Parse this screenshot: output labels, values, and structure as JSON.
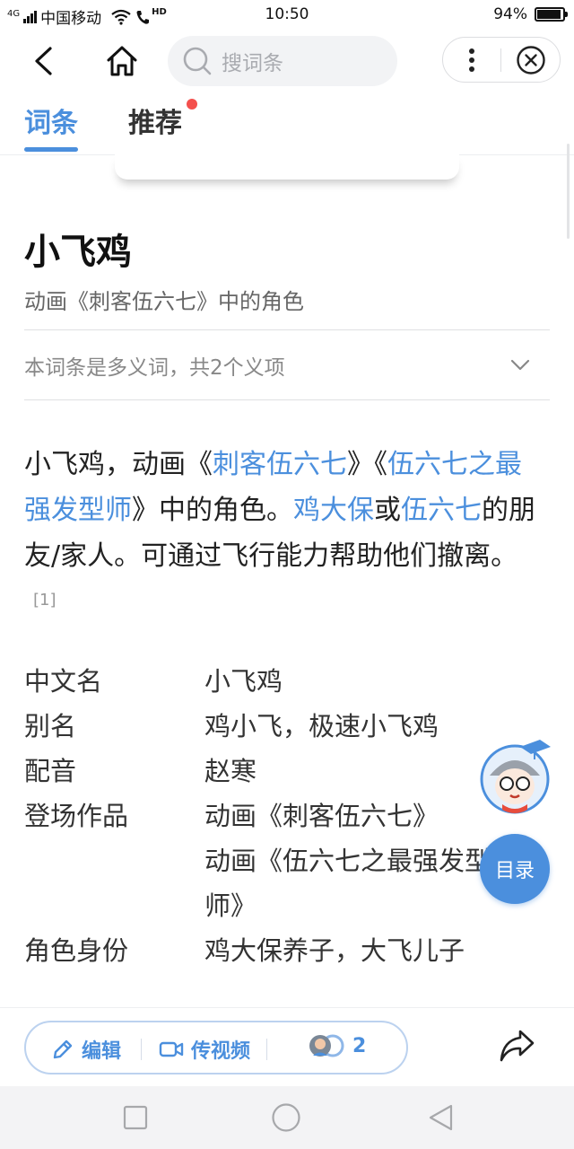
{
  "status_bar": {
    "network": "4G",
    "carrier": "中国移动",
    "hd": "HD",
    "time": "10:50",
    "battery": "94%",
    "battery_level": 0.94
  },
  "nav": {
    "search_placeholder": "搜词条"
  },
  "tabs": [
    {
      "label": "词条",
      "active": true
    },
    {
      "label": "推荐",
      "active": false,
      "has_badge": true
    }
  ],
  "entry": {
    "title": "小飞鸡",
    "subtitle": "动画《刺客伍六七》中的角色",
    "polysemy_note": "本词条是多义词，共2个义项",
    "summary": {
      "p1": "小飞鸡，动画《",
      "l1": "刺客伍六七",
      "p2": "》《",
      "l2": "伍六七之最强发型师",
      "p3": "》中的角色。",
      "l3": "鸡大保",
      "p4": "或",
      "l4": "伍六七",
      "p5": "的朋友/家人。可通过飞行能力帮助他们撤离。",
      "ref": "[1]"
    },
    "infobox": [
      {
        "key": "中文名",
        "value": "小飞鸡"
      },
      {
        "key": "别名",
        "value": "鸡小飞，极速小飞鸡"
      },
      {
        "key": "配音",
        "value": "赵寒"
      },
      {
        "key": "登场作品",
        "value": "动画《刺客伍六七》"
      },
      {
        "key": "",
        "value": "动画《伍六七之最强发型师》"
      },
      {
        "key": "角色身份",
        "value": "鸡大保养子，大飞儿子"
      }
    ]
  },
  "floating": {
    "toc_label": "目录"
  },
  "bottom_bar": {
    "edit_label": "编辑",
    "video_label": "传视频",
    "contributors_count": "2"
  },
  "colors": {
    "accent": "#4b8fdd",
    "badge": "#f4504d"
  }
}
